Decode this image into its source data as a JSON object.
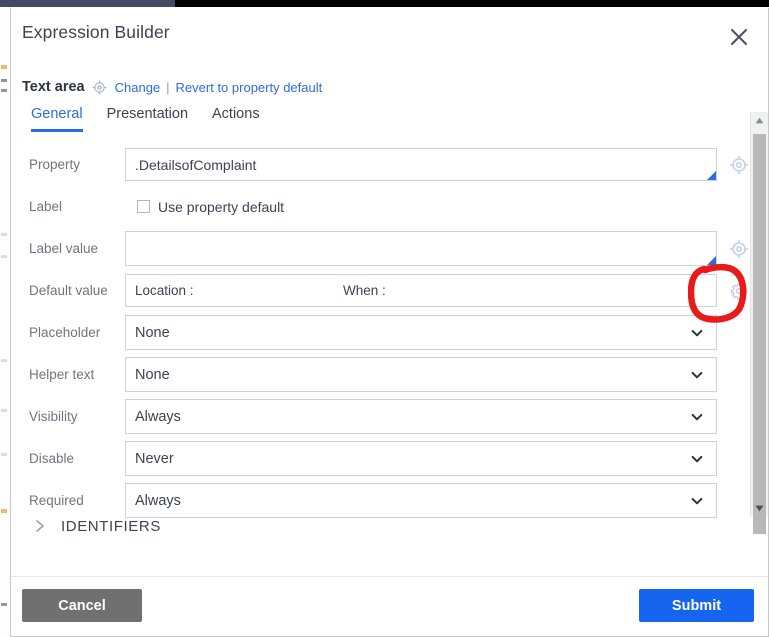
{
  "window": {
    "title": "Expression Builder",
    "close_icon": "close-icon"
  },
  "subheader": {
    "component_name": "Text area",
    "target_icon": "target-icon",
    "change_link": "Change",
    "separator": "|",
    "revert_link": "Revert to property default"
  },
  "tabs": [
    {
      "label": "General",
      "active": true
    },
    {
      "label": "Presentation",
      "active": false
    },
    {
      "label": "Actions",
      "active": false
    }
  ],
  "form": {
    "property": {
      "label": "Property",
      "value": ".DetailsofComplaint",
      "placeholder": "",
      "gear_icon": "target-icon"
    },
    "label_row": {
      "label": "Label",
      "checkbox_label": "Use property default",
      "checked": false
    },
    "label_value": {
      "label": "Label value",
      "value": "",
      "placeholder": "",
      "gear_icon": "target-icon"
    },
    "default_value": {
      "label": "Default value",
      "segment_one": "Location :",
      "segment_two": "When :",
      "gear_icon": "gear-icon"
    },
    "placeholder": {
      "label": "Placeholder",
      "value": "None",
      "chevron_icon": "chevron-down-icon"
    },
    "helper_text": {
      "label": "Helper text",
      "value": "None",
      "chevron_icon": "chevron-down-icon"
    },
    "visibility": {
      "label": "Visibility",
      "value": "Always",
      "chevron_icon": "chevron-down-icon"
    },
    "disable": {
      "label": "Disable",
      "value": "Never",
      "chevron_icon": "chevron-down-icon"
    },
    "required": {
      "label": "Required",
      "value": "Always",
      "chevron_icon": "chevron-down-icon"
    }
  },
  "identifiers": {
    "label": "IDENTIFIERS",
    "chevron_icon": "chevron-right-icon",
    "expanded": false
  },
  "footer": {
    "cancel_label": "Cancel",
    "submit_label": "Submit"
  },
  "annotation": {
    "shape": "hand-drawn-red-circle",
    "color": "#e81a1a",
    "targets": "default-value-gear-icon"
  },
  "colors": {
    "accent_blue": "#2b6ce0",
    "submit_blue": "#1565f0",
    "cancel_gray": "#707070",
    "label_gray": "#6f7480",
    "text_dark": "#3d4354",
    "border": "#cfd2d8",
    "topbar_navy": "#434a63",
    "annotation_red": "#e81a1a"
  }
}
